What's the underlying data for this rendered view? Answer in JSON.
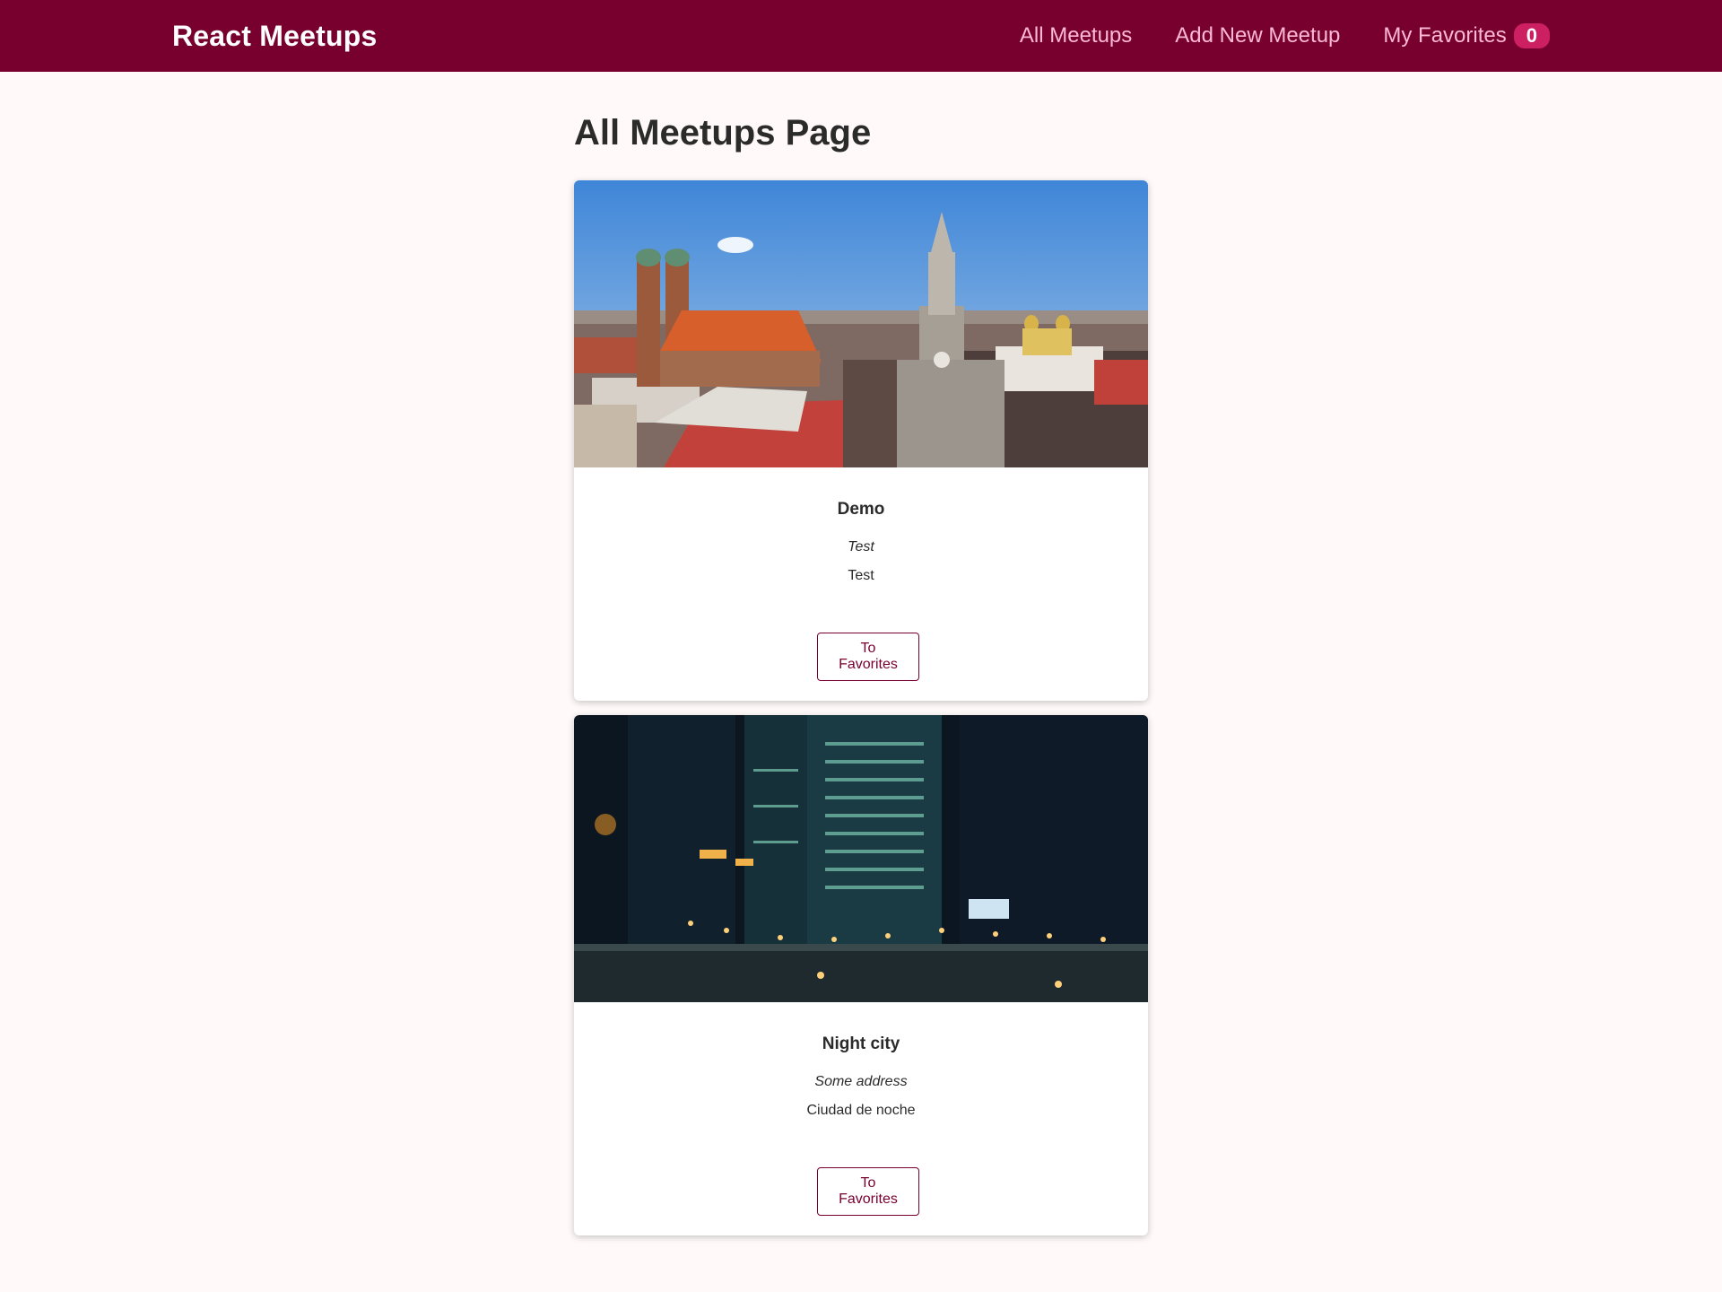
{
  "header": {
    "logo": "React Meetups",
    "nav": {
      "all_meetups": "All Meetups",
      "add_new_meetup": "Add New Meetup",
      "my_favorites": "My Favorites",
      "favorites_count": "0"
    }
  },
  "main": {
    "title": "All Meetups Page",
    "meetups": [
      {
        "title": "Demo",
        "address": "Test",
        "description": "Test",
        "button_label": "To Favorites",
        "image": "munich-cityscape-photo"
      },
      {
        "title": "Night city",
        "address": "Some address",
        "description": "Ciudad de noche",
        "button_label": "To Favorites",
        "image": "night-city-photo"
      }
    ]
  },
  "colors": {
    "header_bg": "#77002e",
    "nav_link": "#fcb8d6",
    "badge_bg": "#cc2062",
    "page_bg": "#fffaf9",
    "accent": "#77002e"
  }
}
